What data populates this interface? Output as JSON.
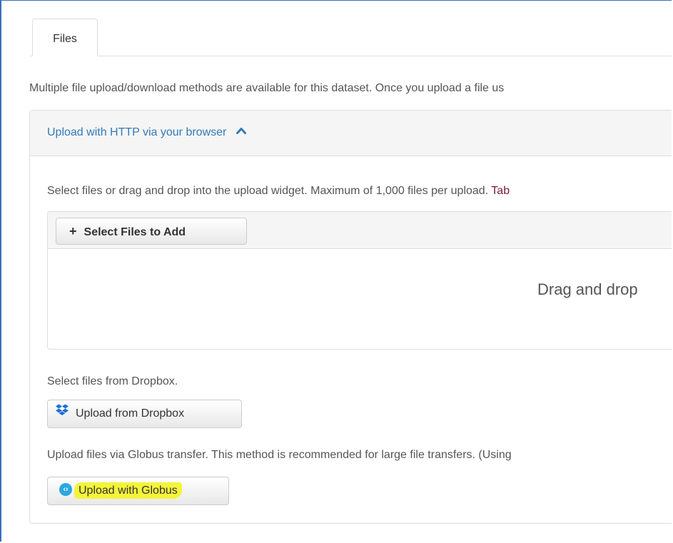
{
  "tabs": [
    {
      "label": "Files"
    }
  ],
  "intro_text": "Multiple file upload/download methods are available for this dataset. Once you upload a file us",
  "http_section": {
    "title": "Upload with HTTP via your browser",
    "help_text": "Select files or drag and drop into the upload widget. Maximum of 1,000 files per upload.",
    "help_link": "Tab",
    "select_button_label": "Select Files to Add",
    "drop_text": "Drag and drop"
  },
  "dropbox_section": {
    "help_text": "Select files from Dropbox.",
    "button_label": "Upload from Dropbox"
  },
  "globus_section": {
    "help_text": "Upload files via Globus transfer. This method is recommended for large file transfers. (Using",
    "button_label": "Upload with Globus",
    "highlight_color": "#f4f43a"
  },
  "colors": {
    "link": "#337ab7",
    "dropbox_blue": "#1f6fd6",
    "globus_blue": "#2aa7e0",
    "frame_border": "#3a6fb6"
  },
  "icons": {
    "collapse": "chevron-up-icon",
    "add": "plus-icon",
    "dropbox": "dropbox-icon",
    "globus": "globus-icon"
  }
}
